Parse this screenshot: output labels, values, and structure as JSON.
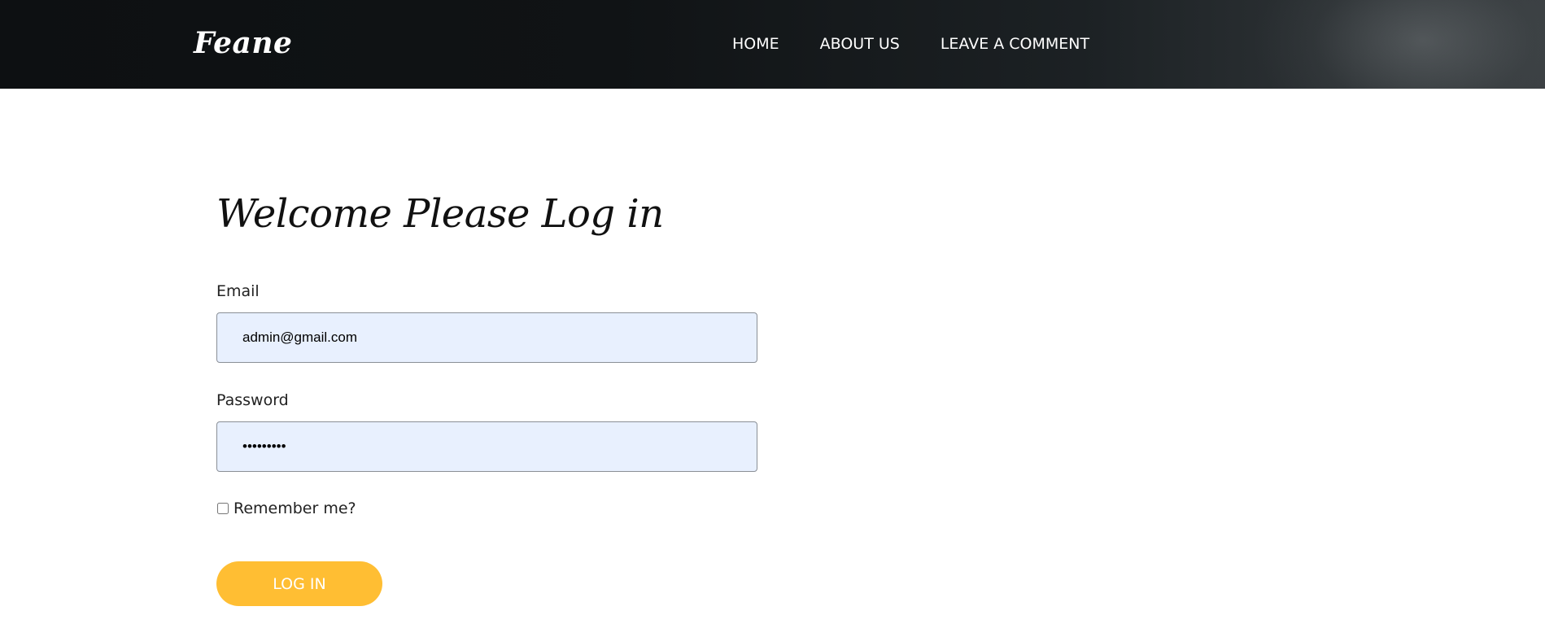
{
  "header": {
    "logo": "Feane",
    "nav": [
      {
        "label": "HOME"
      },
      {
        "label": "ABOUT US"
      },
      {
        "label": "LEAVE A COMMENT"
      }
    ]
  },
  "login": {
    "title": "Welcome Please Log in",
    "email_label": "Email",
    "email_value": "admin@gmail.com",
    "password_label": "Password",
    "password_value": "•••••••••",
    "remember_label": "Remember me?",
    "remember_checked": false,
    "submit_label": "LOG IN"
  },
  "colors": {
    "accent": "#ffbe33",
    "input_background": "#e8f0fe",
    "header_dark": "#0d1012"
  }
}
